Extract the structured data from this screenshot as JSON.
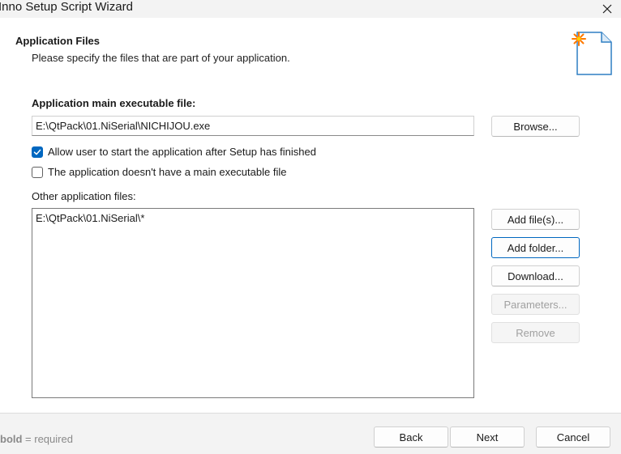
{
  "window": {
    "title": "Inno Setup Script Wizard"
  },
  "header": {
    "title": "Application Files",
    "description": "Please specify the files that are part of your application."
  },
  "main_exe": {
    "label": "Application main executable file:",
    "value": "E:\\QtPack\\01.NiSerial\\NICHIJOU.exe",
    "browse_label": "Browse..."
  },
  "options": {
    "allow_start_label": "Allow user to start the application after Setup has finished",
    "allow_start_checked": true,
    "no_exe_label": "The application doesn't have a main executable file",
    "no_exe_checked": false
  },
  "other_files": {
    "label": "Other application files:",
    "items": [
      "E:\\QtPack\\01.NiSerial\\*"
    ],
    "add_files_label": "Add file(s)...",
    "add_folder_label": "Add folder...",
    "download_label": "Download...",
    "parameters_label": "Parameters...",
    "remove_label": "Remove"
  },
  "footer": {
    "note_bold": "bold",
    "note_rest": " = required",
    "back_label": "Back",
    "next_label": "Next",
    "cancel_label": "Cancel"
  },
  "colors": {
    "accent": "#0067c0",
    "wizard_star": "#ff7a00"
  },
  "icons": [
    "close-icon",
    "wizard-document-icon",
    "checkmark-icon"
  ]
}
